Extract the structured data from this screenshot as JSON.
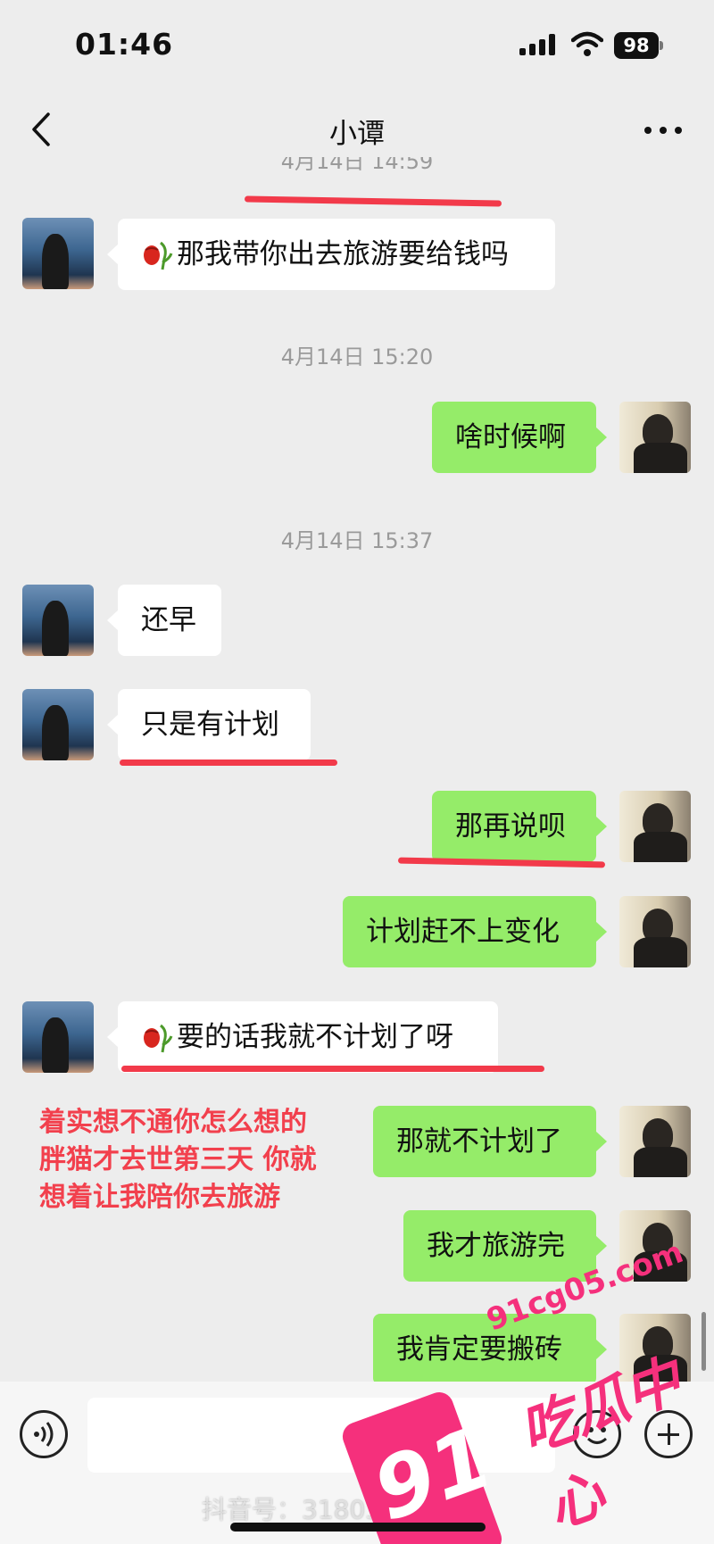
{
  "status_bar": {
    "time": "01:46",
    "battery": "98"
  },
  "nav": {
    "title": "小谭"
  },
  "chat": {
    "timestamps": [
      "4月14日 14:59",
      "4月14日 15:20",
      "4月14日 15:37"
    ],
    "messages": [
      {
        "from": "her",
        "text": "那我带你出去旅游要给钱吗",
        "icon": "wilted-rose-icon"
      },
      {
        "from": "me",
        "text": "啥时候啊"
      },
      {
        "from": "her",
        "text": "还早"
      },
      {
        "from": "her",
        "text": "只是有计划"
      },
      {
        "from": "me",
        "text": "那再说呗"
      },
      {
        "from": "me",
        "text": "计划赶不上变化"
      },
      {
        "from": "her",
        "text": "要的话我就不计划了呀",
        "icon": "wilted-rose-icon"
      },
      {
        "from": "me",
        "text": "那就不计划了"
      },
      {
        "from": "me",
        "text": "我才旅游完"
      },
      {
        "from": "me",
        "text": "我肯定要搬砖"
      }
    ]
  },
  "annotation": {
    "lines": [
      "着实想不通你怎么想的",
      "胖猫才去世第三天 你就",
      "想着让我陪你去旅游"
    ],
    "color": "#f2404d"
  },
  "watermark": {
    "number": "91",
    "url": "91cg05.com",
    "text": "吃瓜中心",
    "douyin": "抖音号：31803188787"
  },
  "colors": {
    "outgoing_bubble": "#95ec69",
    "incoming_bubble": "#ffffff",
    "background": "#ededed",
    "highlight": "#f23a4a"
  }
}
